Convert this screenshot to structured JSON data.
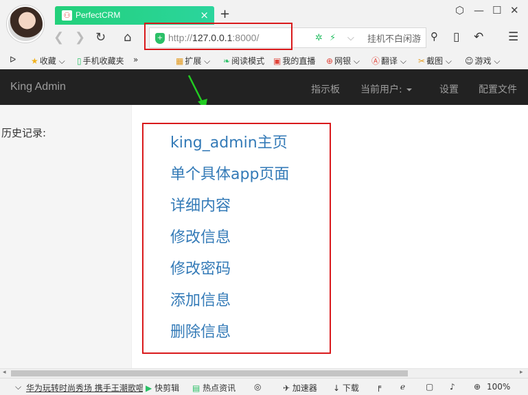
{
  "browser": {
    "tab_title": "PerfectCRM",
    "tab_close": "×",
    "new_tab": "+",
    "url_prefix": "http://",
    "url_host": "127.0.0.1",
    "url_port": ":8000/",
    "search_placeholder": "挂机不白闲游",
    "bookmarks": {
      "toggle": "ᐅ",
      "favorites": "收藏",
      "mobile": "手机收藏夹",
      "more": "»",
      "extensions": "扩展",
      "reader": "阅读模式",
      "live": "我的直播",
      "banking": "网银",
      "translate": "翻译",
      "screenshot": "截图",
      "games": "游戏"
    }
  },
  "app": {
    "brand": "King Admin",
    "nav": {
      "dashboard": "指示板",
      "current_user": "当前用户:",
      "settings": "设置",
      "config": "配置文件"
    },
    "sidebar": {
      "history_label": "历史记录:"
    },
    "links": [
      "king_admin主页",
      "单个具体app页面",
      "详细内容",
      "修改信息",
      "修改密码",
      "添加信息",
      "删除信息"
    ]
  },
  "statusbar": {
    "news": "华为玩转时尚秀场 携手王潮歌唱",
    "quick_clip": "快剪辑",
    "hot_news": "热点资讯",
    "accelerator": "加速器",
    "download": "下载",
    "zoom": "100%"
  },
  "colors": {
    "tab_green": "#23d07a",
    "navbar_bg": "#222222",
    "link_blue": "#337ab7",
    "annotation_red": "#d9191b",
    "annotation_arrow": "#22cc22"
  }
}
